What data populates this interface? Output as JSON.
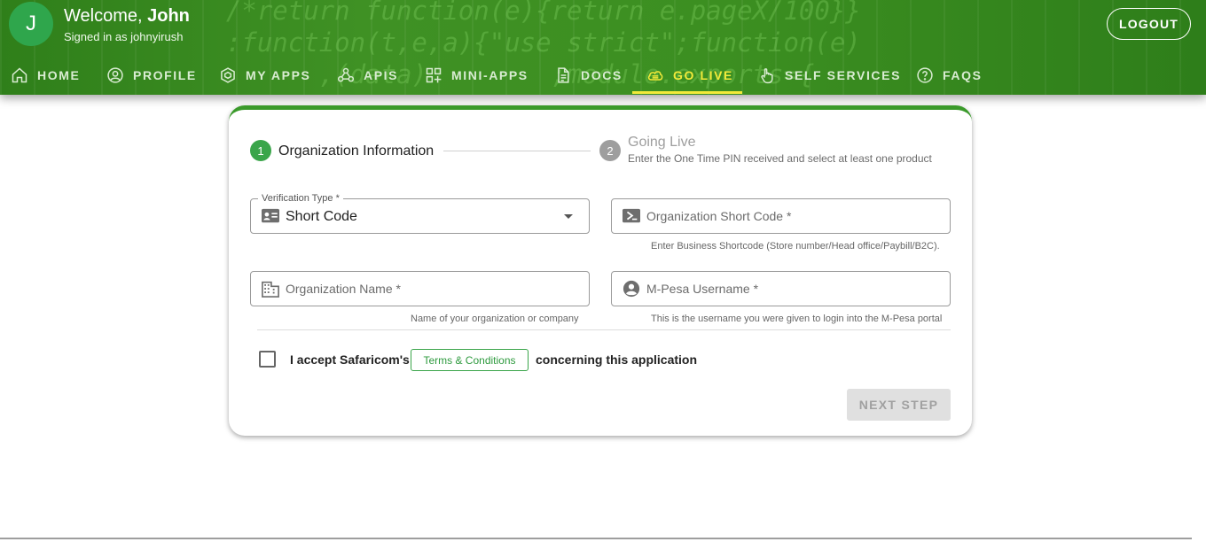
{
  "user": {
    "avatar_letter": "J",
    "welcome_prefix": "Welcome, ",
    "name": "John",
    "signed_in": "Signed in as johnyirush"
  },
  "header": {
    "logout_label": "LOGOUT"
  },
  "nav": {
    "items": [
      {
        "label": "HOME",
        "icon": "home-icon"
      },
      {
        "label": "PROFILE",
        "icon": "profile-icon"
      },
      {
        "label": "MY APPS",
        "icon": "apps-icon"
      },
      {
        "label": "APIS",
        "icon": "webhook-icon"
      },
      {
        "label": "MINI-APPS",
        "icon": "widgets-icon"
      },
      {
        "label": "DOCS",
        "icon": "document-icon"
      },
      {
        "label": "GO LIVE",
        "icon": "cloud-upload-icon"
      },
      {
        "label": "SELF SERVICES",
        "icon": "touch-icon"
      },
      {
        "label": "FAQS",
        "icon": "help-icon"
      }
    ],
    "active": "GO LIVE"
  },
  "stepper": {
    "step1": {
      "number": "1",
      "label": "Organization Information"
    },
    "step2": {
      "number": "2",
      "label": "Going Live",
      "subtitle": "Enter the One Time PIN received and select at least one product"
    }
  },
  "form": {
    "verification_type": {
      "legend": "Verification Type *",
      "value": "Short Code"
    },
    "short_code": {
      "placeholder": "Organization Short Code *",
      "hint": "Enter Business Shortcode (Store number/Head office/Paybill/B2C)."
    },
    "org_name": {
      "placeholder": "Organization Name *",
      "hint": "Name of your organization or company"
    },
    "mpesa_username": {
      "placeholder": "M-Pesa Username *",
      "hint": "This is the username you were given to login into the M-Pesa portal"
    },
    "accept_prefix": "I accept Safaricom's",
    "terms_label": "Terms & Conditions",
    "accept_suffix": "concerning this application",
    "next_label": "NEXT STEP"
  },
  "colors": {
    "header_green": "#3a8f22",
    "active_nav": "#f2ea3a",
    "accent_green": "#3aa54a"
  }
}
